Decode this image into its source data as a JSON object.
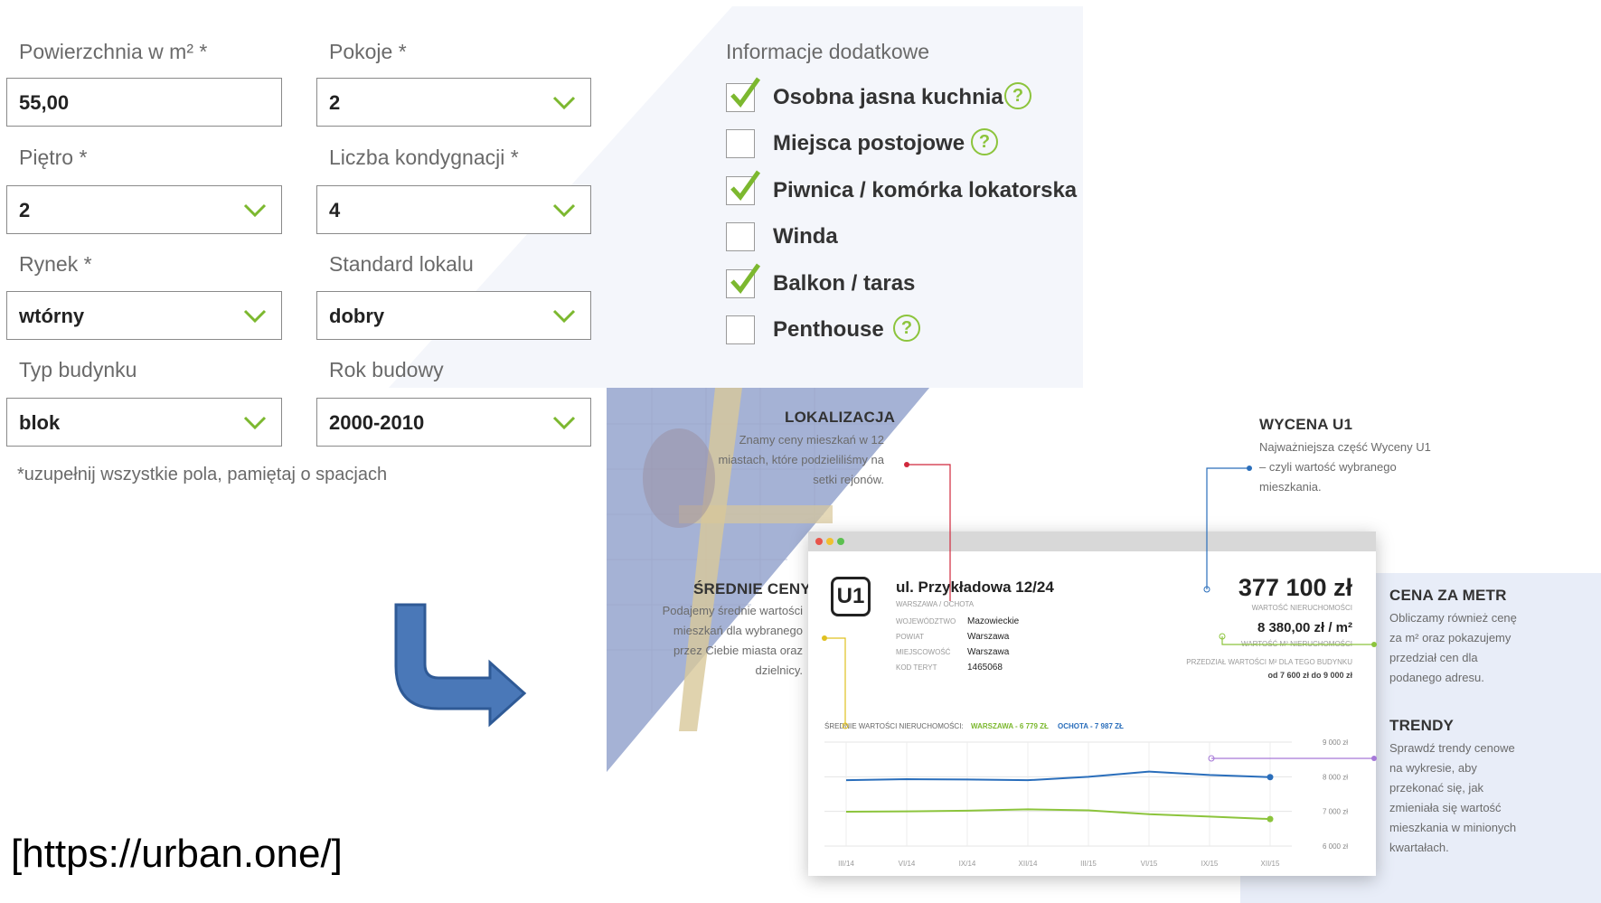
{
  "form": {
    "area": {
      "label": "Powierzchnia w m² *",
      "value": "55,00"
    },
    "rooms": {
      "label": "Pokoje *",
      "value": "2"
    },
    "floor": {
      "label": "Piętro *",
      "value": "2"
    },
    "floors_count": {
      "label": "Liczba kondygnacji *",
      "value": "4"
    },
    "market": {
      "label": "Rynek *",
      "value": "wtórny"
    },
    "standard": {
      "label": "Standard lokalu",
      "value": "dobry"
    },
    "building_type": {
      "label": "Typ budynku",
      "value": "blok"
    },
    "build_year": {
      "label": "Rok budowy",
      "value": "2000-2010"
    },
    "note": "*uzupełnij wszystkie pola, pamiętaj o spacjach"
  },
  "extra": {
    "title": "Informacje dodatkowe",
    "items": [
      {
        "label": "Osobna jasna kuchnia",
        "checked": true,
        "help": "?"
      },
      {
        "label": "Miejsca postojowe",
        "checked": false,
        "help": "?"
      },
      {
        "label": "Piwnica / komórka lokatorska",
        "checked": true
      },
      {
        "label": "Winda",
        "checked": false
      },
      {
        "label": "Balkon / taras",
        "checked": true
      },
      {
        "label": "Penthouse",
        "checked": false,
        "help": "?"
      }
    ]
  },
  "colors": {
    "accent_green": "#8cc43c",
    "line_blue": "#2a6ebb",
    "line_red": "#d0283c",
    "line_yellow": "#e0c020",
    "line_purple": "#a678d8"
  },
  "promo": {
    "lokalizacja": {
      "title": "LOKALIZACJA",
      "text": [
        "Znamy ceny mieszkań w 12",
        "miastach, które podzieliliśmy na",
        "setki rejonów."
      ]
    },
    "srednie": {
      "title": "ŚREDNIE CENY",
      "text": [
        "Podajemy średnie wartości",
        "mieszkań dla wybranego",
        "przez Ciebie miasta oraz",
        "dzielnicy."
      ]
    },
    "wycena": {
      "title": "WYCENA U1",
      "text": [
        "Najważniejsza część Wyceny U1",
        "– czyli wartość wybranego",
        "mieszkania."
      ]
    },
    "cena": {
      "title": "CENA ZA METR",
      "text": [
        "Obliczamy również cenę",
        "za m² oraz pokazujemy",
        "przedział cen dla",
        "podanego adresu."
      ]
    },
    "trendy": {
      "title": "TRENDY",
      "text": [
        "Sprawdź trendy cenowe",
        "na wykresie, aby",
        "przekonać się, jak",
        "zmieniała się wartość",
        "mieszkania w minionych",
        "kwartałach."
      ]
    }
  },
  "report": {
    "logo": "U1",
    "address": "ul. Przykładowa 12/24",
    "district": "WARSZAWA / OCHOTA",
    "details": [
      {
        "k": "WOJEWÓDZTWO",
        "v": "Mazowieckie"
      },
      {
        "k": "POWIAT",
        "v": "Warszawa"
      },
      {
        "k": "MIEJSCOWOŚĆ",
        "v": "Warszawa"
      },
      {
        "k": "KOD TERYT",
        "v": "1465068"
      }
    ],
    "value": "377 100 zł",
    "value_label": "WARTOŚĆ NIERUCHOMOŚCI",
    "price_m2": "8 380,00 zł / m²",
    "price_m2_label": "WARTOŚĆ M² NIERUCHOMOŚCI",
    "range_label": "PRZEDZIAŁ WARTOŚCI M² DLA TEGO BUDYNKU",
    "range": "od 7 600 zł do 9 000 zł",
    "chart_header": "ŚREDNIE WARTOŚCI NIERUCHOMOŚCI:",
    "warszawa": "WARSZAWA - 6 779 ZŁ",
    "ochota": "OCHOTA - 7 987 ZŁ"
  },
  "chart_data": {
    "type": "line",
    "x": [
      "III/14",
      "VI/14",
      "IX/14",
      "XII/14",
      "III/15",
      "VI/15",
      "IX/15",
      "XII/15"
    ],
    "yticks": [
      "9 000 zł",
      "8 000 zł",
      "7 000 zł",
      "6 000 zł"
    ],
    "ylim": [
      6000,
      9000
    ],
    "series": [
      {
        "name": "OCHOTA - 7 987 ZŁ",
        "color": "#2a6ebb",
        "values": [
          7900,
          7930,
          7920,
          7900,
          8000,
          8150,
          8050,
          7990
        ]
      },
      {
        "name": "WARSZAWA - 6 779 ZŁ",
        "color": "#8cc43c",
        "values": [
          6990,
          7000,
          7020,
          7060,
          7030,
          6920,
          6850,
          6780
        ]
      }
    ]
  },
  "source_url": "[https://urban.one/]"
}
